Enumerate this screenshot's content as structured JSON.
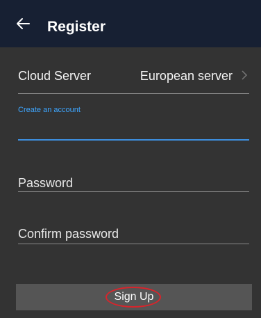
{
  "header": {
    "title": "Register",
    "back_icon": "arrow-left-icon"
  },
  "server": {
    "label": "Cloud Server",
    "value": "European server",
    "chevron_icon": "chevron-right-icon"
  },
  "account": {
    "label": "Create an account",
    "value": ""
  },
  "password": {
    "placeholder": "Password"
  },
  "confirm_password": {
    "placeholder": "Confirm password"
  },
  "signup": {
    "label": "Sign Up"
  },
  "colors": {
    "header_bg": "#172033",
    "page_bg": "#333333",
    "accent": "#3ea6ff",
    "button_bg": "#555555",
    "highlight": "#d9242b"
  }
}
